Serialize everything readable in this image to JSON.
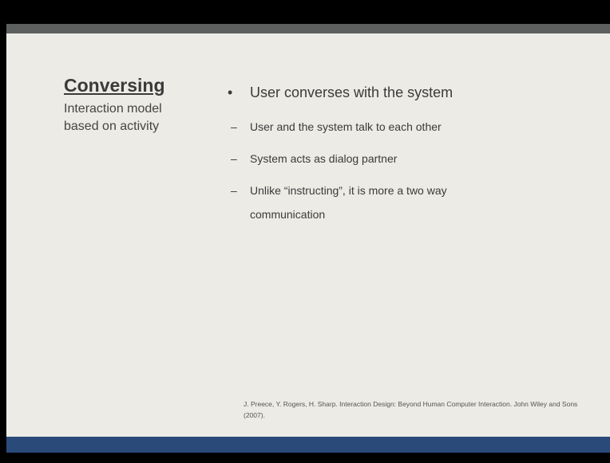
{
  "slide": {
    "title": "Conversing",
    "subtitle": "Interaction model based on activity",
    "bullet": {
      "marker": "•",
      "text": "User converses with the system"
    },
    "subbullets": [
      {
        "marker": "–",
        "text": "User and the system talk to each other"
      },
      {
        "marker": "–",
        "text": "System acts as dialog partner"
      },
      {
        "marker": "–",
        "text": "Unlike “instructing”, it is more a two way communication"
      }
    ],
    "citation": "J. Preece, Y. Rogers, H. Sharp. Interaction Design: Beyond Human Computer Interaction. John Wiley and Sons (2007)."
  },
  "colors": {
    "background": "#ecebe5",
    "top_band": "#5e5f5f",
    "bottom_band": "#2a4a7a",
    "text": "#3a3a3a"
  }
}
